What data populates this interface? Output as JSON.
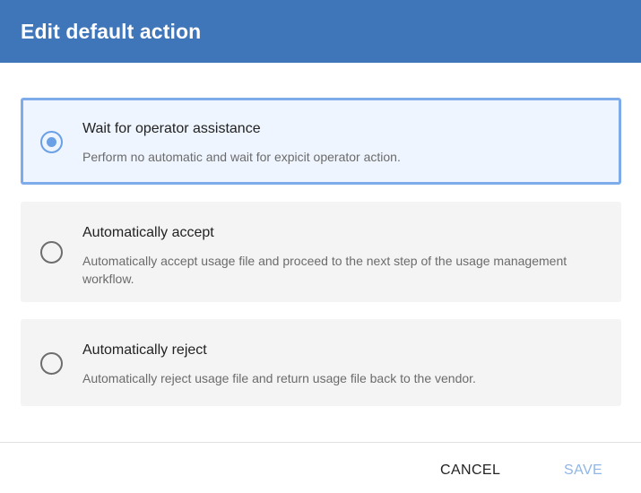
{
  "dialog": {
    "title": "Edit default action",
    "options": [
      {
        "title": "Wait for operator assistance",
        "description": "Perform no automatic and wait for expicit operator action.",
        "selected": true
      },
      {
        "title": "Automatically accept",
        "description": "Automatically accept usage file and proceed to the next step of the usage management workflow.",
        "selected": false
      },
      {
        "title": "Automatically reject",
        "description": "Automatically reject usage file and return usage file back to the vendor.",
        "selected": false
      }
    ],
    "footer": {
      "cancel_label": "CANCEL",
      "save_label": "SAVE"
    }
  },
  "colors": {
    "header_bg": "#3f76b9",
    "accent": "#6aa0e6",
    "selected_bg": "#eef5fe",
    "option_bg": "#f4f4f4",
    "save_disabled": "#8fb6e8"
  }
}
